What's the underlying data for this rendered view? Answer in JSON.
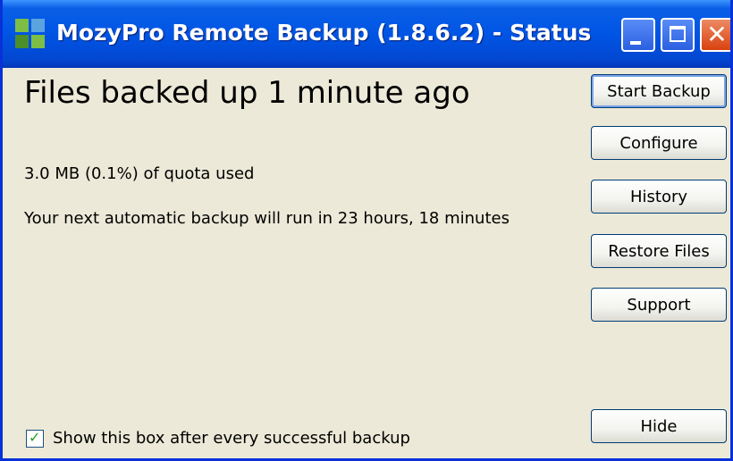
{
  "window": {
    "title": "MozyPro Remote Backup (1.8.6.2) - Status",
    "controls": {
      "minimize_icon": "minimize-icon",
      "maximize_icon": "maximize-icon",
      "close_icon": "close-icon",
      "close_glyph": "✕"
    }
  },
  "status": {
    "heading": "Files backed up 1 minute ago",
    "quota": "3.0 MB (0.1%) of quota used",
    "next_backup": "Your next automatic backup will run in 23 hours, 18 minutes"
  },
  "buttons": {
    "start_backup": "Start Backup",
    "configure": "Configure",
    "history": "History",
    "restore_files": "Restore Files",
    "support": "Support",
    "hide": "Hide"
  },
  "options": {
    "show_after_backup": {
      "label": "Show this box after every successful backup",
      "checked": true,
      "mark": "✓"
    }
  },
  "colors": {
    "titlebar": "#0055e5",
    "window_bg": "#ece9d8",
    "close_button": "#d9420f",
    "check": "#21a121"
  }
}
